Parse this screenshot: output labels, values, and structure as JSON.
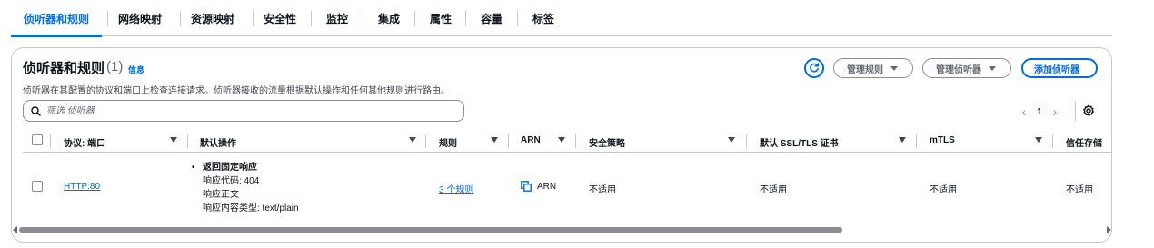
{
  "tabs": [
    {
      "label": "侦听器和规则",
      "active": true
    },
    {
      "label": "网络映射"
    },
    {
      "label": "资源映射"
    },
    {
      "label": "安全性"
    },
    {
      "label": "监控"
    },
    {
      "label": "集成"
    },
    {
      "label": "属性"
    },
    {
      "label": "容量"
    },
    {
      "label": "标签"
    }
  ],
  "panel": {
    "title": "侦听器和规则",
    "count": "(1)",
    "info_link": "信息",
    "description": "侦听器在其配置的协议和端口上检查连接请求。侦听器接收的流量根据默认操作和任何其他规则进行路由。",
    "buttons": {
      "manage_rules": "管理规则",
      "manage_listeners": "管理侦听器",
      "add_listener": "添加侦听器"
    },
    "search": {
      "placeholder": "筛选 侦听器",
      "value": ""
    },
    "pagination": {
      "current_page": "1"
    }
  },
  "table": {
    "columns": [
      "协议: 端口",
      "默认操作",
      "规则",
      "ARN",
      "安全策略",
      "默认 SSL/TLS 证书",
      "mTLS",
      "信任存储"
    ],
    "rows": [
      {
        "protocol_port": "HTTP:80",
        "default_action": {
          "title": "返回固定响应",
          "lines": [
            "响应代码: 404",
            "响应正文",
            "响应内容类型: text/plain"
          ]
        },
        "rules": "3 个规则",
        "arn": "ARN",
        "security_policy": "不适用",
        "default_cert": "不适用",
        "mtls": "不适用",
        "trust_store": "不适用"
      }
    ]
  },
  "colors": {
    "accent": "#006ce0",
    "text": "#0f141a",
    "muted": "#656871",
    "border": "#c6c6cd"
  },
  "icons": [
    "refresh-icon",
    "search-icon",
    "chevron-left-icon",
    "chevron-right-icon",
    "settings-gear-icon",
    "copy-icon",
    "caret-down-icon"
  ]
}
